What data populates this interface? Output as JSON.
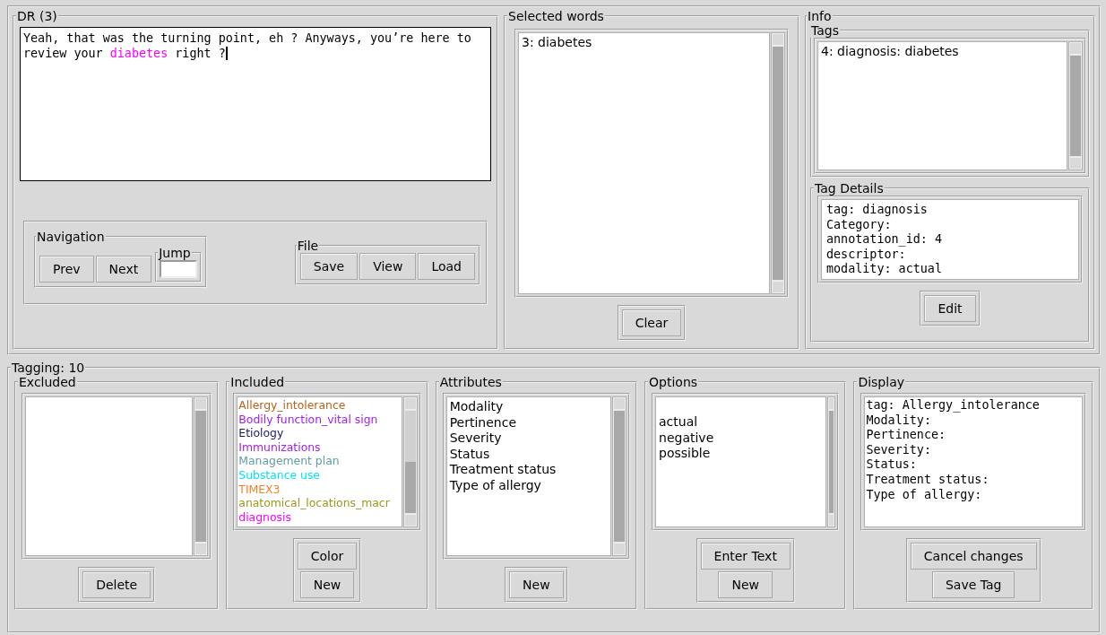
{
  "dr": {
    "title": "DR (3)",
    "text": [
      {
        "text": "Yeah, that was the turning point, eh ? Anyways, you’re here to review your ",
        "color": "#000000"
      },
      {
        "text": "diabetes",
        "color": "#ff00ff"
      },
      {
        "text": " right ?",
        "color": "#000000"
      }
    ]
  },
  "navigation": {
    "title": "Navigation",
    "buttons": [
      "Prev",
      "Next"
    ],
    "jump_label": "Jump"
  },
  "file": {
    "title": "File",
    "buttons": [
      "Save",
      "View",
      "Load"
    ]
  },
  "selected_words": {
    "title": "Selected words",
    "items": [
      "3: diabetes"
    ],
    "button": "Clear"
  },
  "info": {
    "title": "Info",
    "tags": {
      "title": "Tags",
      "items": [
        "4: diagnosis: diabetes"
      ]
    },
    "tag_details": {
      "title": "Tag Details",
      "lines": [
        "tag: diagnosis",
        "Category:",
        "annotation_id: 4",
        "descriptor:",
        "modality: actual"
      ],
      "button": "Edit"
    }
  },
  "tagging": {
    "title": "Tagging: 10",
    "excluded": {
      "title": "Excluded",
      "buttons": [
        "Delete"
      ]
    },
    "included": {
      "title": "Included",
      "items": [
        {
          "label": "Allergy_intolerance",
          "color": "#b8621b"
        },
        {
          "label": "Bodily function_vital sign",
          "color": "#a020f0"
        },
        {
          "label": "Etiology",
          "color": "#191970"
        },
        {
          "label": "Immunizations",
          "color": "#a020f0"
        },
        {
          "label": "Management plan",
          "color": "#5f9ea0"
        },
        {
          "label": "Substance use",
          "color": "#00e5ee"
        },
        {
          "label": "TIMEX3",
          "color": "#ff7f24"
        },
        {
          "label": "anatomical_locations_macr",
          "color": "#9a9a1a"
        },
        {
          "label": "diagnosis",
          "color": "#ff00ff"
        }
      ],
      "buttons": [
        "Color",
        "New"
      ]
    },
    "attributes": {
      "title": "Attributes",
      "items": [
        "Modality",
        "Pertinence",
        "Severity",
        "Status",
        "Treatment status",
        "Type of allergy"
      ],
      "buttons": [
        "New"
      ]
    },
    "options": {
      "title": "Options",
      "items": [
        "actual",
        "negative",
        "possible"
      ],
      "buttons": [
        "Enter Text",
        "New"
      ]
    },
    "display": {
      "title": "Display",
      "lines": [
        "tag: Allergy_intolerance",
        "Modality:",
        "Pertinence:",
        "Severity:",
        "Status:",
        "Treatment status:",
        "Type of allergy:"
      ],
      "buttons": [
        "Cancel changes",
        "Save Tag"
      ]
    }
  }
}
